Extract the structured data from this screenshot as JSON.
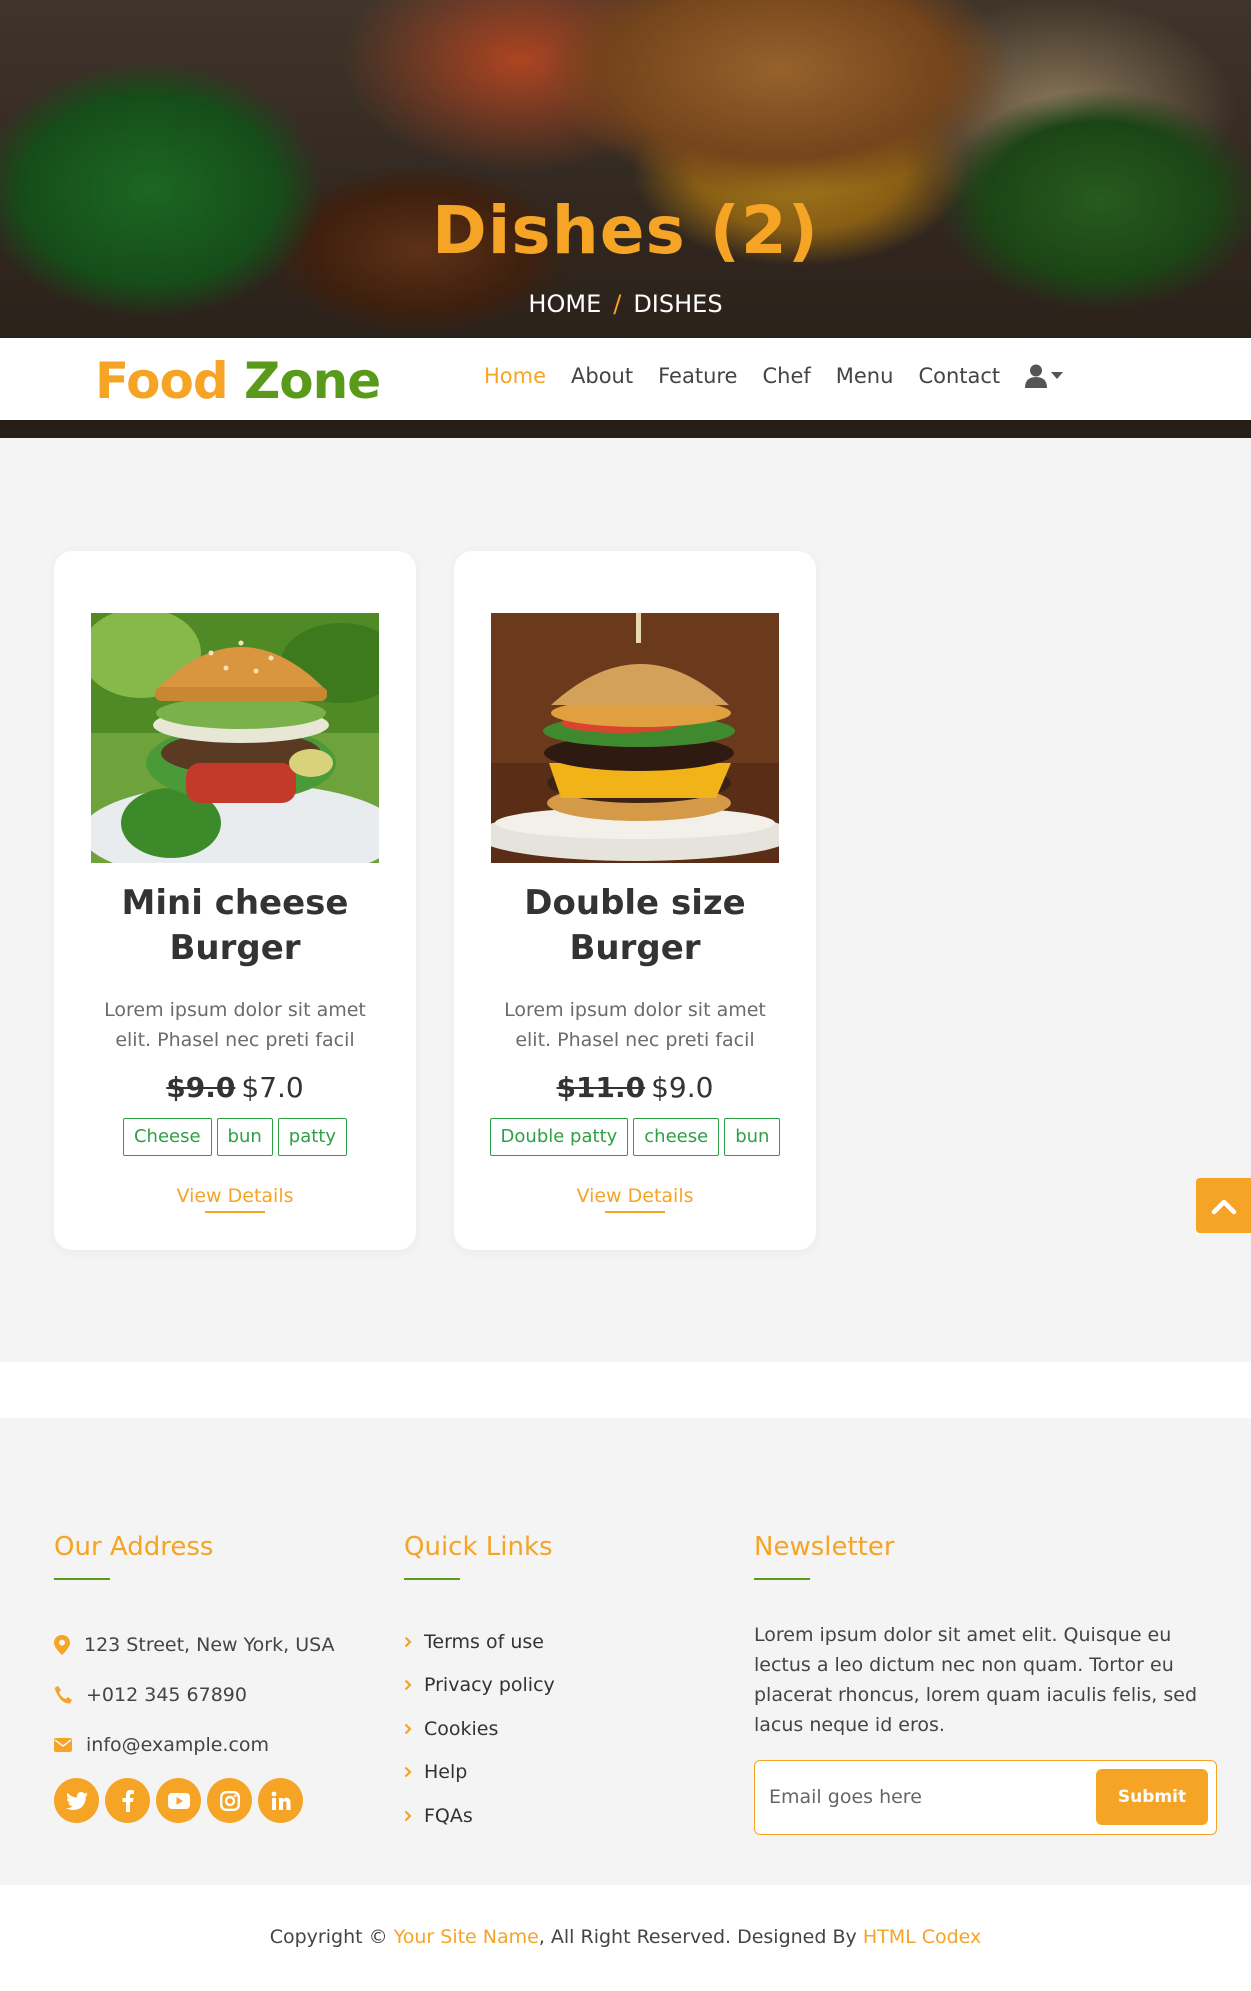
{
  "hero": {
    "title": "Dishes (2)",
    "breadcrumb_home": "HOME",
    "breadcrumb_sep": "/",
    "breadcrumb_current": "DISHES"
  },
  "navbar": {
    "brand_part1": "Food",
    "brand_part2": "Zone",
    "links": [
      {
        "label": "Home",
        "active": true
      },
      {
        "label": "About"
      },
      {
        "label": "Feature"
      },
      {
        "label": "Chef"
      },
      {
        "label": "Menu"
      },
      {
        "label": "Contact"
      }
    ],
    "user_icon": "user-icon"
  },
  "dishes": [
    {
      "title": "Mini cheese Burger",
      "description": "Lorem ipsum dolor sit amet elit. Phasel nec preti facil",
      "old_price": "$9.0",
      "new_price": "$7.0",
      "tags": [
        "Cheese",
        "bun",
        "patty"
      ],
      "details_label": "View Details"
    },
    {
      "title": "Double size Burger",
      "description": "Lorem ipsum dolor sit amet elit. Phasel nec preti facil",
      "old_price": "$11.0",
      "new_price": "$9.0",
      "tags": [
        "Double patty",
        "cheese",
        "bun"
      ],
      "details_label": "View Details"
    }
  ],
  "footer": {
    "address": {
      "heading": "Our Address",
      "street": "123 Street, New York, USA",
      "phone": "+012 345 67890",
      "email": "info@example.com",
      "socials": [
        "twitter-icon",
        "facebook-icon",
        "youtube-icon",
        "instagram-icon",
        "linkedin-icon"
      ]
    },
    "quick_links": {
      "heading": "Quick Links",
      "items": [
        "Terms of use",
        "Privacy policy",
        "Cookies",
        "Help",
        "FQAs"
      ]
    },
    "newsletter": {
      "heading": "Newsletter",
      "text": "Lorem ipsum dolor sit amet elit. Quisque eu lectus a leo dictum nec non quam. Tortor eu placerat rhoncus, lorem quam iaculis felis, sed lacus neque id eros.",
      "email_placeholder": "Email goes here",
      "submit_label": "Submit"
    }
  },
  "copyright": {
    "prefix": "Copyright ©",
    "site_name": "Your Site Name",
    "middle": ", All Right Reserved. Designed By",
    "designer": "HTML Codex"
  },
  "colors": {
    "accent": "#f5a425",
    "green": "#5a9a1a",
    "tag_green": "#2ea045"
  }
}
